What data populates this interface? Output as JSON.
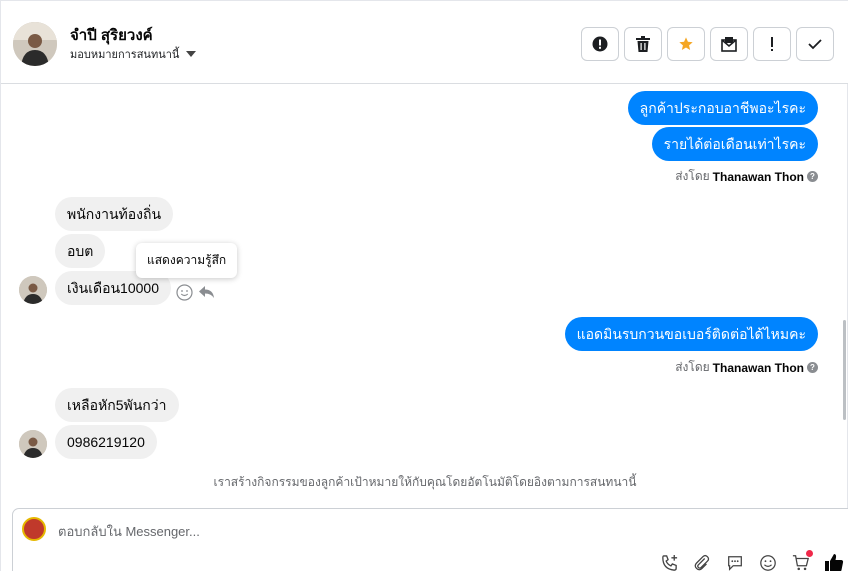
{
  "contact": {
    "name": "จำปี สุริยวงค์",
    "assign_label": "มอบหมายการสนทนานี้"
  },
  "header_actions": [
    {
      "icon": "alert-circle-icon",
      "label": "!"
    },
    {
      "icon": "trash-icon"
    },
    {
      "icon": "star-icon",
      "color": "#f5a623"
    },
    {
      "icon": "mark-unread-icon"
    },
    {
      "icon": "exclamation-icon",
      "label": "!"
    },
    {
      "icon": "check-icon"
    }
  ],
  "messages": {
    "out1": "ลูกค้าประกอบอาชีพอะไรคะ",
    "out2": "รายได้ต่อเดือนเท่าไรคะ",
    "sent_by_1_prefix": "ส่งโดย",
    "sent_by_1_name": "Thanawan Thon",
    "in1": "พนักงานท้องถิ่น",
    "in2": "อบต",
    "in3": "เงินเดือน10000",
    "tooltip": "แสดงความรู้สึก",
    "out3": "แอดมินรบกวนขอเบอร์ติดต่อได้ไหมคะ",
    "sent_by_2_prefix": "ส่งโดย",
    "sent_by_2_name": "Thanawan Thon",
    "in4": "เหลือหัก5พันกว่า",
    "in5": "0986219120",
    "notice": "เราสร้างกิจกรรมของลูกค้าเป้าหมายให้กับคุณโดยอัตโนมัติโดยอิงตามการสนทนานี้"
  },
  "composer": {
    "placeholder": "ตอบกลับใน Messenger..."
  },
  "colors": {
    "outgoing_bubble": "#0084ff",
    "incoming_bubble": "#f0f0f0",
    "star": "#f5a623",
    "like": "#050505"
  }
}
